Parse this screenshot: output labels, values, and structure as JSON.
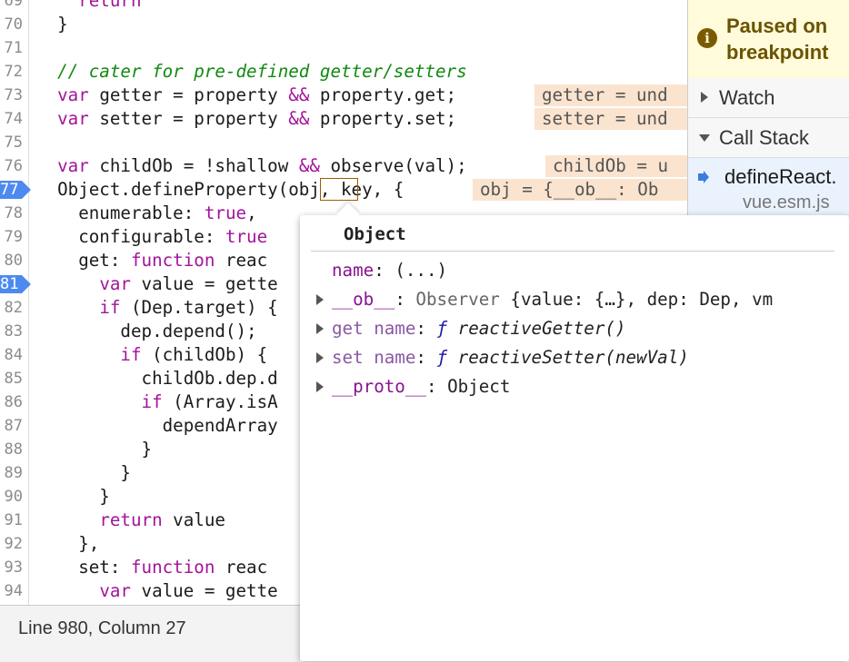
{
  "editor": {
    "line_numbers": [
      "69",
      "70",
      "71",
      "72",
      "73",
      "74",
      "75",
      "76",
      "77",
      "78",
      "79",
      "80",
      "81",
      "82",
      "83",
      "84",
      "85",
      "86",
      "87",
      "88",
      "89",
      "90",
      "91",
      "92",
      "93",
      "94"
    ],
    "breakpoints": [
      "77",
      "81"
    ],
    "lines": [
      "    return",
      "  }",
      "",
      "  // cater for pre-defined getter/setters",
      "  var getter = property && property.get;",
      "  var setter = property && property.set;",
      "",
      "  var childOb = !shallow && observe(val);",
      "  Object.defineProperty(obj, key, {",
      "    enumerable: true,",
      "    configurable: true",
      "    get: function reac",
      "      var value = gette",
      "      if (Dep.target) {",
      "        dep.depend();",
      "        if (childOb) {",
      "          childOb.dep.d",
      "          if (Array.isA",
      "            dependArray",
      "          }",
      "        }",
      "      }",
      "      return value",
      "    },",
      "    set: function reac",
      "      var value = gette"
    ],
    "inline_values": {
      "getter": "getter = und",
      "setter": "setter = und",
      "childOb": "childOb = u",
      "obj": "obj = {__ob__: Ob"
    }
  },
  "status_bar": {
    "position": "Line 980, Column 27"
  },
  "sidebar": {
    "paused_text": "Paused on\nbreakpoint",
    "watch_label": "Watch",
    "call_stack_label": "Call Stack",
    "call_stack_item": {
      "function": "defineReact.",
      "file": "vue.esm.js"
    }
  },
  "popover": {
    "title": "Object",
    "properties": [
      {
        "key": "name",
        "value": "(...)",
        "expandable": false
      },
      {
        "key": "__ob__",
        "value": "Observer {value: {…}, dep: Dep, vm",
        "expandable": true
      },
      {
        "key": "get name",
        "value": "ƒ reactiveGetter()",
        "expandable": true
      },
      {
        "key": "set name",
        "value": "ƒ reactiveSetter(newVal)",
        "expandable": true
      },
      {
        "key": "__proto__",
        "value": "Object",
        "expandable": true
      }
    ]
  }
}
